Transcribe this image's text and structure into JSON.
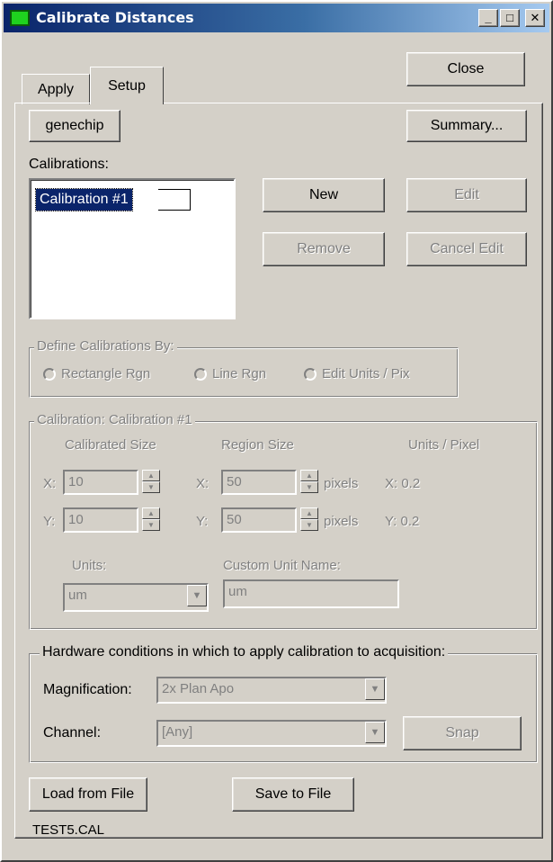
{
  "window": {
    "title": "Calibrate Distances",
    "min_glyph": "_",
    "max_glyph": "□",
    "close_glyph": "✕"
  },
  "tabs": [
    {
      "label": "Apply"
    },
    {
      "label": "Setup"
    }
  ],
  "buttons": {
    "close": "Close",
    "genechip": "genechip",
    "summary": "Summary...",
    "new": "New",
    "edit": "Edit",
    "remove": "Remove",
    "cancel_edit": "Cancel Edit",
    "snap": "Snap",
    "load": "Load from File",
    "save": "Save to File"
  },
  "calibrations": {
    "label": "Calibrations:",
    "items": [
      "Calibration #1"
    ]
  },
  "define_by": {
    "title": "Define Calibrations By:",
    "options": [
      "Rectangle Rgn",
      "Line Rgn",
      "Edit Units / Pix"
    ]
  },
  "calibration": {
    "title": "Calibration: Calibration #1",
    "calibrated_size_label": "Calibrated Size",
    "region_size_label": "Region Size",
    "units_per_pixel_label": "Units / Pixel",
    "x_label": "X:",
    "y_label": "Y:",
    "cal_x": "10",
    "cal_y": "10",
    "region_x": "50",
    "region_y": "50",
    "pixels_label": "pixels",
    "upp_x": "X: 0.2",
    "upp_y": "Y: 0.2",
    "units_label": "Units:",
    "units_value": "um",
    "custom_unit_label": "Custom Unit Name:",
    "custom_unit_value": "um"
  },
  "hardware": {
    "title": "Hardware conditions in which to apply calibration to acquisition:",
    "magnification_label": "Magnification:",
    "magnification_value": "2x Plan Apo",
    "channel_label": "Channel:",
    "channel_value": "[Any]"
  },
  "file_name": "TEST5.CAL",
  "icons": {
    "spin_up": "▲",
    "spin_down": "▼",
    "dropdown": "▼"
  }
}
